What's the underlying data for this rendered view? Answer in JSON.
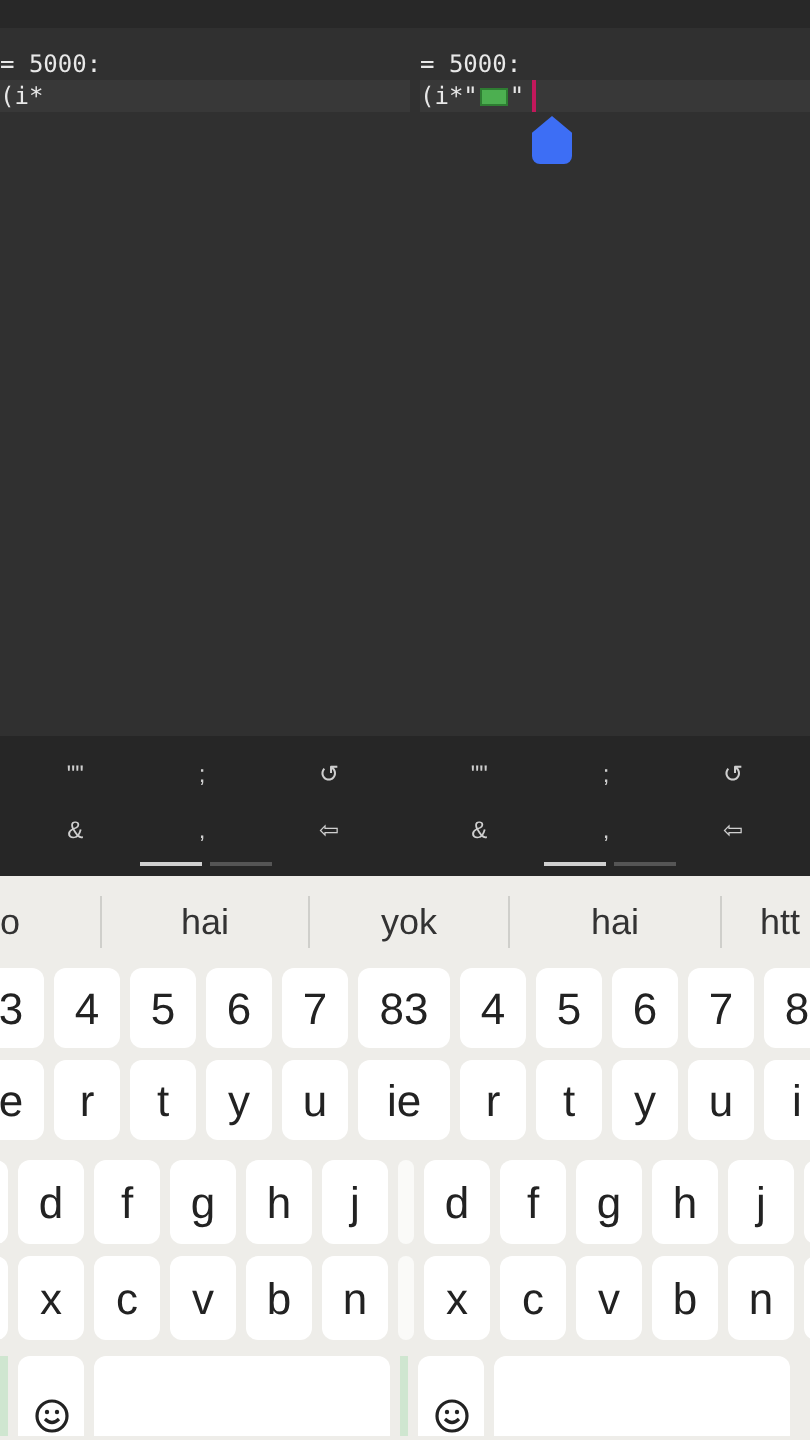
{
  "editor": {
    "panes": [
      {
        "lines": [
          {
            "current": false,
            "parts": [
              {
                "kind": "text",
                "text": "= 5000:"
              }
            ]
          },
          {
            "current": true,
            "parts": [
              {
                "kind": "text",
                "text": "(i*"
              }
            ]
          }
        ],
        "cursor": false
      },
      {
        "lines": [
          {
            "current": false,
            "parts": [
              {
                "kind": "text",
                "text": "= 5000:"
              }
            ]
          },
          {
            "current": true,
            "parts": [
              {
                "kind": "text",
                "text": "(i*\""
              },
              {
                "kind": "money"
              },
              {
                "kind": "text",
                "text": "\""
              }
            ]
          }
        ],
        "cursor": true
      }
    ]
  },
  "extra_keys": {
    "panels": [
      {
        "rows": [
          [
            "\"\"",
            ";",
            "↺"
          ],
          [
            "&",
            ",",
            "⇦"
          ]
        ],
        "pages": [
          {
            "selected": true
          },
          {
            "selected": false
          }
        ]
      },
      {
        "rows": [
          [
            "\"\"",
            ";",
            "↺"
          ],
          [
            "&",
            ",",
            "⇦"
          ]
        ],
        "pages": [
          {
            "selected": true
          },
          {
            "selected": false
          }
        ]
      }
    ]
  },
  "suggestions": [
    "o",
    "hai",
    "yok",
    "hai",
    "htt"
  ],
  "keyboard": {
    "rows": [
      [
        {
          "kind": "key",
          "label": "3"
        },
        {
          "kind": "key",
          "label": "4"
        },
        {
          "kind": "key",
          "label": "5"
        },
        {
          "kind": "key",
          "label": "6"
        },
        {
          "kind": "key",
          "label": "7"
        },
        {
          "kind": "wide",
          "label": "83"
        },
        {
          "kind": "key",
          "label": "4"
        },
        {
          "kind": "key",
          "label": "5"
        },
        {
          "kind": "key",
          "label": "6"
        },
        {
          "kind": "key",
          "label": "7"
        },
        {
          "kind": "key",
          "label": "8"
        }
      ],
      [
        {
          "kind": "key",
          "label": "e"
        },
        {
          "kind": "key",
          "label": "r"
        },
        {
          "kind": "key",
          "label": "t"
        },
        {
          "kind": "key",
          "label": "y"
        },
        {
          "kind": "key",
          "label": "u"
        },
        {
          "kind": "wide",
          "label": "ie"
        },
        {
          "kind": "key",
          "label": "r"
        },
        {
          "kind": "key",
          "label": "t"
        },
        {
          "kind": "key",
          "label": "y"
        },
        {
          "kind": "key",
          "label": "u"
        },
        {
          "kind": "key",
          "label": "i"
        }
      ],
      [
        {
          "kind": "blank"
        },
        {
          "kind": "key",
          "label": "d"
        },
        {
          "kind": "key",
          "label": "f"
        },
        {
          "kind": "key",
          "label": "g"
        },
        {
          "kind": "key",
          "label": "h"
        },
        {
          "kind": "key",
          "label": "j"
        },
        {
          "kind": "sliver"
        },
        {
          "kind": "key",
          "label": "d"
        },
        {
          "kind": "key",
          "label": "f"
        },
        {
          "kind": "key",
          "label": "g"
        },
        {
          "kind": "key",
          "label": "h"
        },
        {
          "kind": "key",
          "label": "j"
        },
        {
          "kind": "blank"
        }
      ],
      [
        {
          "kind": "blank"
        },
        {
          "kind": "key",
          "label": "x"
        },
        {
          "kind": "key",
          "label": "c"
        },
        {
          "kind": "key",
          "label": "v"
        },
        {
          "kind": "key",
          "label": "b"
        },
        {
          "kind": "key",
          "label": "n"
        },
        {
          "kind": "sliver"
        },
        {
          "kind": "key",
          "label": "x"
        },
        {
          "kind": "key",
          "label": "c"
        },
        {
          "kind": "key",
          "label": "v"
        },
        {
          "kind": "key",
          "label": "b"
        },
        {
          "kind": "key",
          "label": "n"
        },
        {
          "kind": "blank"
        }
      ],
      [
        {
          "kind": "green"
        },
        {
          "kind": "emoji"
        },
        {
          "kind": "space"
        },
        {
          "kind": "green"
        },
        {
          "kind": "emoji"
        },
        {
          "kind": "space"
        }
      ]
    ]
  }
}
